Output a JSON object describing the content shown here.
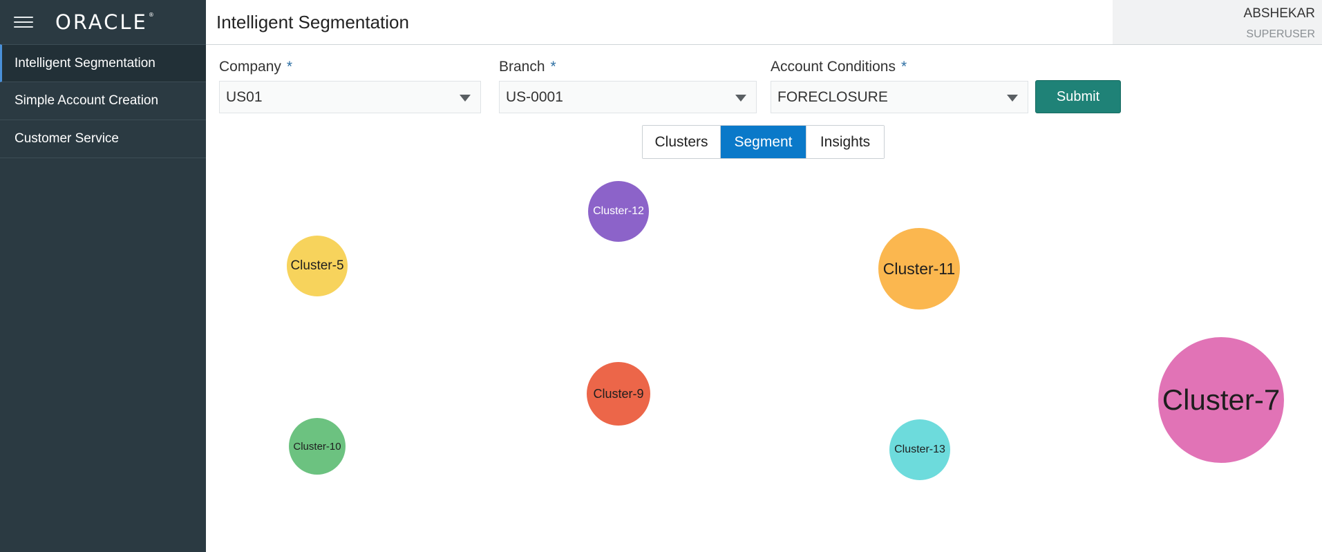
{
  "header": {
    "brand": "ORACLE",
    "title": "Intelligent Segmentation",
    "user_name": "ABSHEKAR",
    "user_role": "SUPERUSER"
  },
  "sidebar": {
    "items": [
      {
        "label": "Intelligent Segmentation",
        "active": true
      },
      {
        "label": "Simple Account Creation",
        "active": false
      },
      {
        "label": "Customer Service",
        "active": false
      }
    ]
  },
  "form": {
    "company": {
      "label": "Company",
      "value": "US01",
      "required": "*"
    },
    "branch": {
      "label": "Branch",
      "value": "US-0001",
      "required": "*"
    },
    "account_conditions": {
      "label": "Account Conditions",
      "value": "FORECLOSURE",
      "required": "*"
    },
    "submit_label": "Submit"
  },
  "tabs": [
    {
      "label": "Clusters",
      "selected": false
    },
    {
      "label": "Segment",
      "selected": true
    },
    {
      "label": "Insights",
      "selected": false
    }
  ],
  "clusters": [
    {
      "label": "Cluster-12",
      "color": "#8c63c9"
    },
    {
      "label": "Cluster-5",
      "color": "#f7d35c"
    },
    {
      "label": "Cluster-11",
      "color": "#fbb74f"
    },
    {
      "label": "Cluster-7",
      "color": "#e173b6"
    },
    {
      "label": "Cluster-9",
      "color": "#ec6649"
    },
    {
      "label": "Cluster-10",
      "color": "#6cc280"
    },
    {
      "label": "Cluster-13",
      "color": "#6ddbdc"
    }
  ],
  "colors": {
    "sidebar_bg": "#2b3a42",
    "accent_selected_tab": "#0a79c9",
    "submit_button": "#1f8277"
  },
  "icons": [
    "hamburger-menu-icon",
    "dropdown-caret-icon"
  ]
}
